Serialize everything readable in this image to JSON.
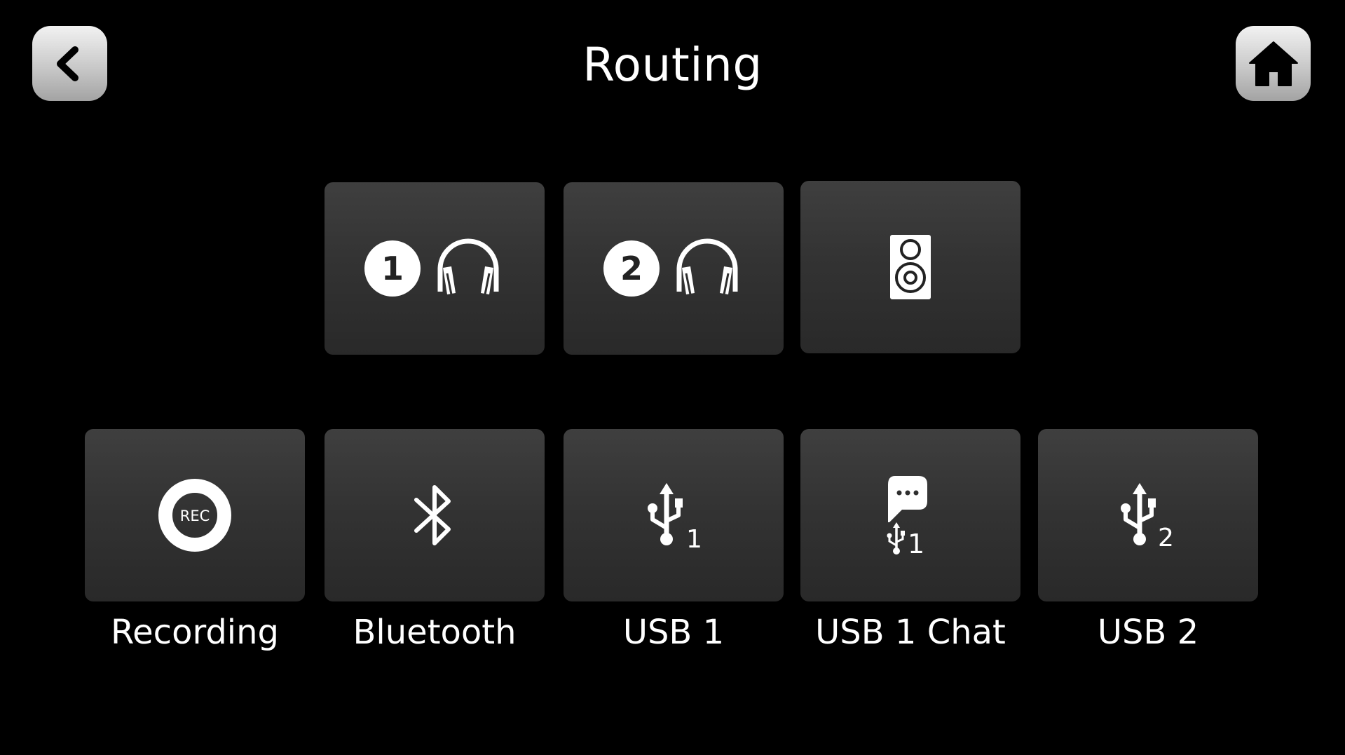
{
  "header": {
    "title": "Routing",
    "back_icon": "chevron-left-icon",
    "home_icon": "home-icon"
  },
  "outputs": [
    {
      "id": "headphones-1",
      "icon": "headphones-icon",
      "badge": "1"
    },
    {
      "id": "headphones-2",
      "icon": "headphones-icon",
      "badge": "2"
    },
    {
      "id": "speakers",
      "icon": "speaker-icon"
    }
  ],
  "sources": [
    {
      "id": "recording",
      "icon": "rec-icon",
      "icon_text": "REC",
      "label": "Recording"
    },
    {
      "id": "bluetooth",
      "icon": "bluetooth-icon",
      "label": "Bluetooth"
    },
    {
      "id": "usb1",
      "icon": "usb-icon",
      "icon_text": "1",
      "label": "USB 1"
    },
    {
      "id": "usb1-chat",
      "icon": "chat-usb-icon",
      "icon_text": "1",
      "label": "USB 1 Chat"
    },
    {
      "id": "usb2",
      "icon": "usb-icon",
      "icon_text": "2",
      "label": "USB 2"
    }
  ]
}
